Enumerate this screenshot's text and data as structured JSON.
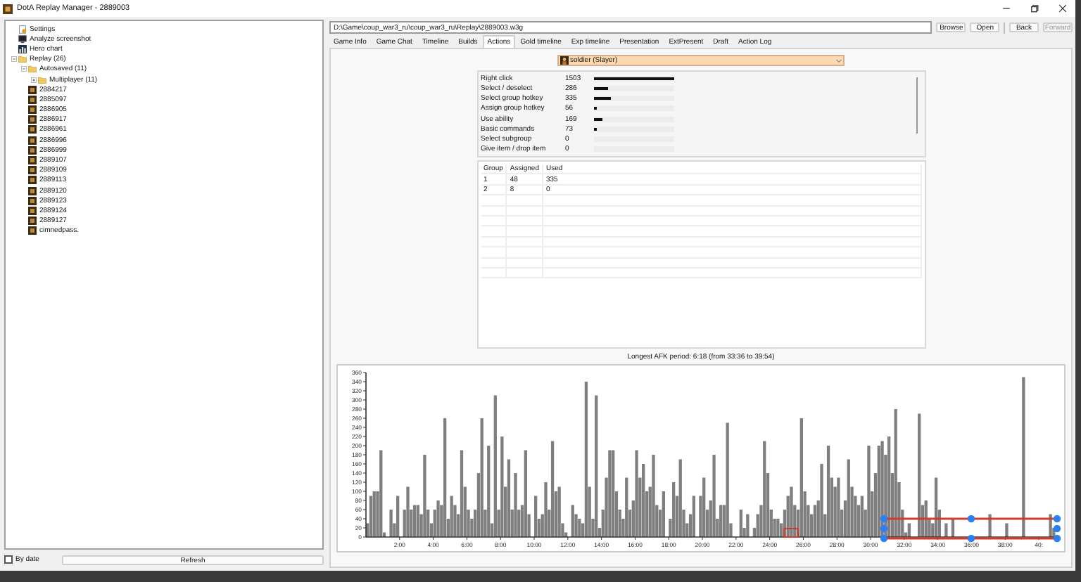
{
  "window": {
    "title": "DotA Replay Manager - 2889003"
  },
  "sidebar": {
    "tree": [
      {
        "label": "Settings",
        "kind": "settings"
      },
      {
        "label": "Analyze screenshot",
        "kind": "screenshot"
      },
      {
        "label": "Hero chart",
        "kind": "chart"
      },
      {
        "label": "Replay (26)",
        "kind": "folder",
        "expanded": true,
        "children": [
          {
            "label": "Autosaved (11)",
            "kind": "folder",
            "expanded": true,
            "children": [
              {
                "label": "Multiplayer (11)",
                "kind": "folder",
                "expanded": false
              }
            ]
          },
          {
            "label": "2884217",
            "kind": "replay"
          },
          {
            "label": "2885097",
            "kind": "replay"
          },
          {
            "label": "2886905",
            "kind": "replay"
          },
          {
            "label": "2886917",
            "kind": "replay"
          },
          {
            "label": "2886961",
            "kind": "replay"
          },
          {
            "label": "2886996",
            "kind": "replay"
          },
          {
            "label": "2886999",
            "kind": "replay"
          },
          {
            "label": "2889107",
            "kind": "replay"
          },
          {
            "label": "2889109",
            "kind": "replay"
          },
          {
            "label": "2889113",
            "kind": "replay"
          },
          {
            "label": "2889120",
            "kind": "replay"
          },
          {
            "label": "2889123",
            "kind": "replay"
          },
          {
            "label": "2889124",
            "kind": "replay"
          },
          {
            "label": "2889127",
            "kind": "replay"
          },
          {
            "label": "cimnedpass.",
            "kind": "replay"
          }
        ]
      }
    ],
    "by_date": {
      "label": "By date",
      "checked": false
    },
    "refresh_button": "Refresh"
  },
  "path": {
    "value": "D:\\Game\\coup_war3_ru\\coup_war3_ru\\Replay\\2889003.w3g"
  },
  "toolbar": [
    {
      "label": "Browse",
      "disabled": false
    },
    {
      "label": "Open",
      "disabled": false
    },
    {
      "label": "Back",
      "disabled": false
    },
    {
      "label": "Forward",
      "disabled": true
    }
  ],
  "tabs": [
    {
      "label": "Game Info",
      "selected": false
    },
    {
      "label": "Game Chat",
      "selected": false
    },
    {
      "label": "Timeline",
      "selected": false
    },
    {
      "label": "Builds",
      "selected": false
    },
    {
      "label": "Actions",
      "selected": true
    },
    {
      "label": "Gold timeline",
      "selected": false
    },
    {
      "label": "Exp timeline",
      "selected": false
    },
    {
      "label": "Presentation",
      "selected": false
    },
    {
      "label": "ExtPresent",
      "selected": false
    },
    {
      "label": "Draft",
      "selected": false
    },
    {
      "label": "Action Log",
      "selected": false
    }
  ],
  "player_select": {
    "value": "soldier (Slayer)"
  },
  "actions": [
    {
      "name": "Right click",
      "count": "1503",
      "level": 1
    },
    {
      "name": "Select / deselect",
      "count": "286",
      "level": 0.19
    },
    {
      "name": "Select group hotkey",
      "count": "335",
      "level": 0.22
    },
    {
      "name": "Assign group hotkey",
      "count": "56",
      "level": 0.04
    },
    {
      "name": "Use ability",
      "count": "169",
      "level": 0.11
    },
    {
      "name": "Basic commands",
      "count": "73",
      "level": 0.05
    },
    {
      "name": "Select subgroup",
      "count": "0"
    },
    {
      "name": "Give item / drop item",
      "count": "0"
    }
  ],
  "groups": {
    "columns": [
      "Group",
      "Assigned",
      "Used"
    ],
    "rows": [
      [
        "1",
        "48",
        "335"
      ],
      [
        "2",
        "8",
        "0"
      ]
    ]
  },
  "afk_text": "Longest AFK period: 6:18 (from 33:36 to 39:54)",
  "chart_data": {
    "type": "bar",
    "xlim": [
      0,
      41
    ],
    "ylim": [
      0,
      360
    ],
    "yticks": [
      0,
      20,
      40,
      60,
      80,
      100,
      120,
      140,
      160,
      180,
      200,
      220,
      240,
      260,
      280,
      300,
      320,
      340,
      360
    ],
    "xticks": [
      {
        "value": 2,
        "label": "2:00"
      },
      {
        "value": 4,
        "label": "4:00"
      },
      {
        "value": 6,
        "label": "6:00"
      },
      {
        "value": 8,
        "label": "8:00"
      },
      {
        "value": 10,
        "label": "10:00"
      },
      {
        "value": 12,
        "label": "12:00"
      },
      {
        "value": 14,
        "label": "14:00"
      },
      {
        "value": 16,
        "label": "16:00"
      },
      {
        "value": 18,
        "label": "18:00"
      },
      {
        "value": 20,
        "label": "20:00"
      },
      {
        "value": 22,
        "label": "22:00"
      },
      {
        "value": 24,
        "label": "24:00"
      },
      {
        "value": 26,
        "label": "26:00"
      },
      {
        "value": 28,
        "label": "28:00"
      },
      {
        "value": 30,
        "label": "30:00"
      },
      {
        "value": 32,
        "label": "32:00"
      },
      {
        "value": 34,
        "label": "34:00"
      },
      {
        "value": 36,
        "label": "36:00"
      },
      {
        "value": 38,
        "label": "38:00"
      },
      {
        "value": 40,
        "label": "40:"
      }
    ],
    "x": [
      0,
      0.2,
      0.4,
      0.6,
      0.8,
      1,
      1.2,
      1.4,
      1.6,
      1.8,
      2,
      2.2,
      2.4,
      2.6,
      2.8,
      3,
      3.2,
      3.4,
      3.6,
      3.8,
      4,
      4.2,
      4.4,
      4.6,
      4.8,
      5,
      5.2,
      5.4,
      5.6,
      5.8,
      6,
      6.2,
      6.4,
      6.6,
      6.8,
      7,
      7.2,
      7.4,
      7.6,
      7.8,
      8,
      8.2,
      8.4,
      8.6,
      8.8,
      9,
      9.2,
      9.4,
      9.6,
      9.8,
      10,
      10.2,
      10.4,
      10.6,
      10.8,
      11,
      11.2,
      11.4,
      11.6,
      11.8,
      12,
      12.2,
      12.4,
      12.6,
      12.8,
      13,
      13.2,
      13.4,
      13.6,
      13.8,
      14,
      14.2,
      14.4,
      14.6,
      14.8,
      15,
      15.2,
      15.4,
      15.6,
      15.8,
      16,
      16.2,
      16.4,
      16.6,
      16.8,
      17,
      17.2,
      17.4,
      17.6,
      17.8,
      18,
      18.2,
      18.4,
      18.6,
      18.8,
      19,
      19.2,
      19.4,
      19.6,
      19.8,
      20,
      20.2,
      20.4,
      20.6,
      20.8,
      21,
      21.2,
      21.4,
      21.6,
      21.8,
      22,
      22.2,
      22.4,
      22.6,
      22.8,
      23,
      23.2,
      23.4,
      23.6,
      23.8,
      24,
      24.2,
      24.4,
      24.6,
      24.8,
      25,
      25.2,
      25.4,
      25.6,
      25.8,
      26,
      26.2,
      26.4,
      26.6,
      26.8,
      27,
      27.2,
      27.4,
      27.6,
      27.8,
      28,
      28.2,
      28.4,
      28.6,
      28.8,
      29,
      29.2,
      29.4,
      29.6,
      29.8,
      30,
      30.2,
      30.4,
      30.6,
      30.8,
      31,
      31.2,
      31.4,
      31.6,
      31.8,
      32,
      32.2,
      32.4,
      32.6,
      32.8,
      33,
      33.2,
      33.4,
      33.6,
      33.8,
      34,
      34.2,
      34.4,
      34.6,
      34.8,
      35,
      35.2,
      35.4,
      35.6,
      35.8,
      36,
      36.2,
      36.4,
      36.6,
      36.8,
      37,
      37.2,
      37.4,
      37.6,
      37.8,
      38,
      38.2,
      38.4,
      38.6,
      38.8,
      39,
      39.2,
      39.4,
      39.6,
      39.8,
      40,
      40.2,
      40.4,
      40.6,
      40.8
    ],
    "series": [
      {
        "color": "#7f7f7f",
        "values": [
          30,
          90,
          100,
          100,
          190,
          10,
          0,
          60,
          30,
          90,
          0,
          60,
          110,
          60,
          70,
          70,
          50,
          180,
          60,
          30,
          60,
          80,
          70,
          260,
          40,
          90,
          70,
          50,
          190,
          110,
          60,
          40,
          60,
          140,
          260,
          60,
          200,
          30,
          310,
          60,
          220,
          110,
          170,
          60,
          140,
          60,
          70,
          190,
          50,
          0,
          90,
          40,
          50,
          120,
          60,
          210,
          100,
          110,
          30,
          10,
          0,
          70,
          50,
          40,
          30,
          340,
          110,
          40,
          310,
          20,
          60,
          130,
          190,
          190,
          100,
          60,
          40,
          130,
          60,
          80,
          190,
          130,
          160,
          100,
          110,
          180,
          70,
          60,
          100,
          0,
          40,
          120,
          90,
          170,
          60,
          30,
          50,
          90,
          0,
          90,
          130,
          60,
          80,
          180,
          40,
          70,
          70,
          250,
          30,
          0,
          0,
          60,
          20,
          50,
          0,
          20,
          50,
          70,
          210,
          140,
          60,
          40,
          40,
          30,
          60,
          90,
          110,
          70,
          60,
          260,
          100,
          70,
          50,
          70,
          80,
          160,
          50,
          200,
          130,
          110,
          130,
          60,
          80,
          170,
          110,
          90,
          70,
          90,
          60,
          200,
          100,
          140,
          200,
          210,
          180,
          220,
          140,
          280,
          120,
          60,
          10,
          30,
          0,
          0,
          270,
          70,
          80,
          40,
          30,
          130,
          60,
          0,
          30,
          0,
          40,
          0,
          0,
          0,
          0,
          0,
          0,
          0,
          0,
          0,
          0,
          50,
          0,
          0,
          0,
          0,
          30,
          0,
          0,
          0,
          0,
          350,
          0,
          0,
          0,
          0,
          0,
          0,
          0,
          50,
          20
        ]
      }
    ]
  }
}
